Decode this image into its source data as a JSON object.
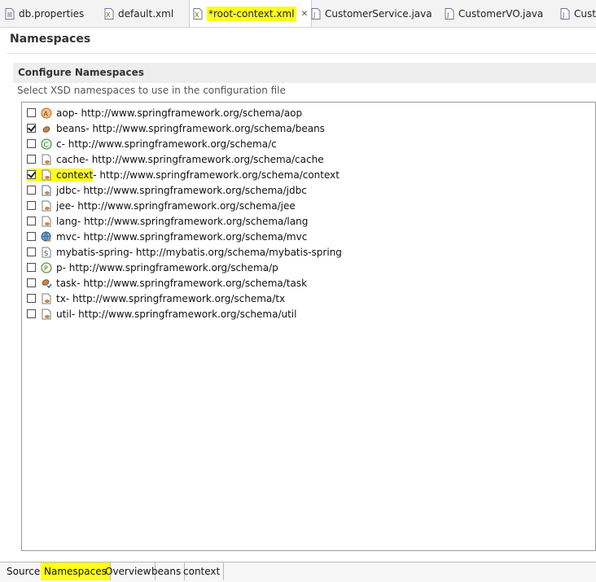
{
  "editor_tabs": [
    {
      "label": "db.properties",
      "icon": "properties-file-icon"
    },
    {
      "label": "default.xml",
      "icon": "xml-file-icon"
    },
    {
      "label": "*root-context.xml",
      "icon": "xml-file-icon",
      "active": true,
      "close": "✕"
    },
    {
      "label": "CustomerService.java",
      "icon": "java-file-icon"
    },
    {
      "label": "CustomerVO.java",
      "icon": "java-file-icon"
    },
    {
      "label": "Custo",
      "icon": "java-file-icon"
    }
  ],
  "page": {
    "title": "Namespaces",
    "section_title": "Configure Namespaces",
    "section_desc": "Select XSD namespaces to use in the configuration file"
  },
  "namespaces": [
    {
      "prefix": "aop",
      "uri": " - http://www.springframework.org/schema/aop",
      "checked": false,
      "icon": "aop-icon"
    },
    {
      "prefix": "beans",
      "uri": " - http://www.springframework.org/schema/beans",
      "checked": true,
      "icon": "beans-icon"
    },
    {
      "prefix": "c",
      "uri": " - http://www.springframework.org/schema/c",
      "checked": false,
      "icon": "c-namespace-icon"
    },
    {
      "prefix": "cache",
      "uri": " - http://www.springframework.org/schema/cache",
      "checked": false,
      "icon": "cache-icon"
    },
    {
      "prefix": "context",
      "uri": " - http://www.springframework.org/schema/context",
      "checked": true,
      "icon": "context-icon",
      "highlight": true
    },
    {
      "prefix": "jdbc",
      "uri": " - http://www.springframework.org/schema/jdbc",
      "checked": false,
      "icon": "jdbc-icon"
    },
    {
      "prefix": "jee",
      "uri": " - http://www.springframework.org/schema/jee",
      "checked": false,
      "icon": "jee-icon"
    },
    {
      "prefix": "lang",
      "uri": " - http://www.springframework.org/schema/lang",
      "checked": false,
      "icon": "lang-icon"
    },
    {
      "prefix": "mvc",
      "uri": " - http://www.springframework.org/schema/mvc",
      "checked": false,
      "icon": "mvc-icon"
    },
    {
      "prefix": "mybatis-spring",
      "uri": " - http://mybatis.org/schema/mybatis-spring",
      "checked": false,
      "icon": "mybatis-icon"
    },
    {
      "prefix": "p",
      "uri": " - http://www.springframework.org/schema/p",
      "checked": false,
      "icon": "p-namespace-icon"
    },
    {
      "prefix": "task",
      "uri": " - http://www.springframework.org/schema/task",
      "checked": false,
      "icon": "task-icon"
    },
    {
      "prefix": "tx",
      "uri": " - http://www.springframework.org/schema/tx",
      "checked": false,
      "icon": "tx-icon"
    },
    {
      "prefix": "util",
      "uri": " - http://www.springframework.org/schema/util",
      "checked": false,
      "icon": "util-icon"
    }
  ],
  "bottom_tabs": [
    {
      "label": "Source"
    },
    {
      "label": "Namespaces",
      "active": true
    },
    {
      "label": "Overview"
    },
    {
      "label": "beans"
    },
    {
      "label": "context"
    }
  ],
  "colors": {
    "highlight": "#ffff1a",
    "section_bg": "#eeeeee",
    "list_border": "#9a9a9a"
  }
}
